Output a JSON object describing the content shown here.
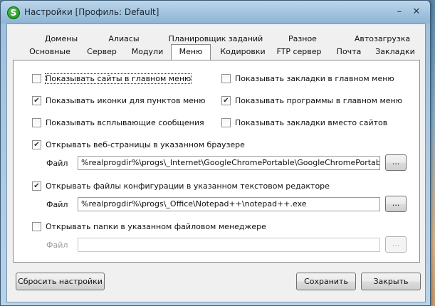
{
  "window": {
    "icon_letter": "S",
    "title": "Настройки [Профиль: Default]",
    "minimize": "–",
    "close": "✕"
  },
  "tabs_row1": [
    "Домены",
    "Алиасы",
    "Планировщик заданий",
    "Разное",
    "Автозагрузка"
  ],
  "tabs_row2": [
    "Основные",
    "Сервер",
    "Модули",
    "Меню",
    "Кодировки",
    "FTP сервер",
    "Почта",
    "Закладки"
  ],
  "active_tab": "Меню",
  "options": {
    "show_sites": {
      "label": "Показывать сайты в главном меню",
      "checked": false
    },
    "show_bookmarks": {
      "label": "Показывать закладки в главном меню",
      "checked": false
    },
    "show_icons": {
      "label": "Показывать иконки для пунктов меню",
      "checked": true
    },
    "show_programs": {
      "label": "Показывать программы в главном меню",
      "checked": true
    },
    "show_popups": {
      "label": "Показывать всплывающие сообщения",
      "checked": false
    },
    "bookmarks_instead": {
      "label": "Показывать закладки вместо сайтов",
      "checked": false
    }
  },
  "browser": {
    "label": "Открывать веб-страницы в указанном браузере",
    "checked": true,
    "file_label": "Файл",
    "file_value": "%realprogdir%\\progs\\_Internet\\GoogleChromePortable\\GoogleChromePortable.exe",
    "browse": "..."
  },
  "editor": {
    "label": "Открывать файлы конфигурации в указанном текстовом редакторе",
    "checked": true,
    "file_label": "Файл",
    "file_value": "%realprogdir%\\progs\\_Office\\Notepad++\\notepad++.exe",
    "browse": "..."
  },
  "filemanager": {
    "label": "Открывать папки в указанном файловом менеджере",
    "checked": false,
    "file_label": "Файл",
    "file_value": "",
    "browse": "..."
  },
  "buttons": {
    "reset": "Сбросить настройки",
    "save": "Сохранить",
    "close": "Закрыть"
  }
}
